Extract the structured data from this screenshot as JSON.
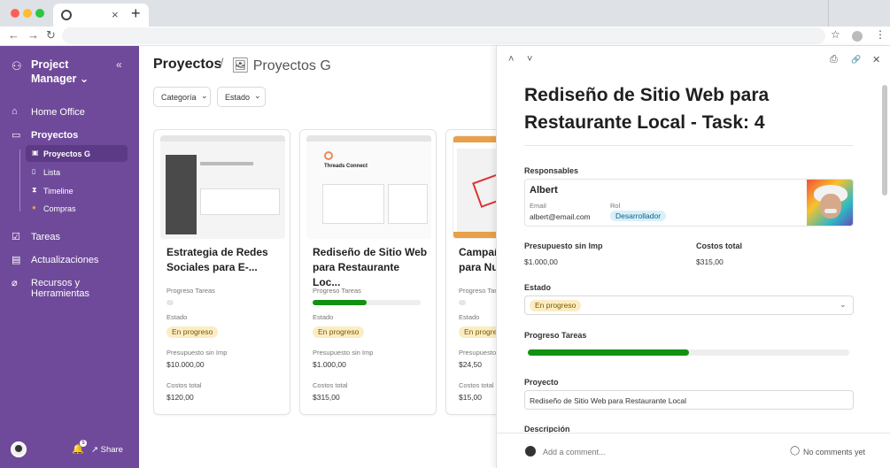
{
  "browser": {
    "tab_close": "×",
    "new_tab": "+",
    "back": "←",
    "forward": "→",
    "reload": "↻",
    "star": "☆",
    "menu": "⋮"
  },
  "sidebar": {
    "brand": "Project Manager",
    "brand_caret": "⌄",
    "collapse": "«",
    "items": [
      {
        "label": "Home Office",
        "icon": "home-icon",
        "glyph": "⌂"
      },
      {
        "label": "Proyectos",
        "icon": "folder-icon",
        "glyph": "▭"
      },
      {
        "label": "Tareas",
        "icon": "checkbox-icon",
        "glyph": "☑"
      },
      {
        "label": "Actualizaciones",
        "icon": "inbox-icon",
        "glyph": "▤"
      },
      {
        "label": "Recursos y Herramientas",
        "icon": "paperclip-icon",
        "glyph": "⌀"
      }
    ],
    "sub_items": [
      {
        "label": "Proyectos G",
        "icon": "picture-icon",
        "glyph": "▣"
      },
      {
        "label": "Lista",
        "icon": "page-icon",
        "glyph": "▯"
      },
      {
        "label": "Timeline",
        "icon": "hourglass-icon",
        "glyph": "⧗"
      },
      {
        "label": "Compras",
        "icon": "bag-icon",
        "glyph": "●"
      }
    ],
    "notifications_count": "5",
    "bell": "🔔",
    "share": "Share"
  },
  "main": {
    "breadcrumb_root": "Proyectos",
    "breadcrumb_sep": "/",
    "breadcrumb_current": "🖼 Proyectos G",
    "filters": [
      "Categoría",
      "Estado"
    ],
    "filter_caret": "⌄",
    "labels": {
      "progress": "Progreso Tareas",
      "status": "Estado",
      "budget": "Presupuesto sin Imp",
      "costs": "Costos total"
    },
    "cards": [
      {
        "title": "Estrategia de Redes Sociales para E-...",
        "status": "En progreso",
        "progress": 0,
        "budget": "$10.000,00",
        "costs": "$120,00"
      },
      {
        "title": "Rediseño de Sitio Web para Restaurante Loc...",
        "status": "En progreso",
        "progress": 0.5,
        "budget": "$1.000,00",
        "costs": "$315,00"
      },
      {
        "title": "Campaña de Marketing para Nu...",
        "status": "En progreso",
        "progress": 0,
        "budget": "$24,50",
        "costs": "$15,00"
      }
    ]
  },
  "panel": {
    "toolbar": {
      "up": "˄",
      "down": "˅",
      "print": "⎙",
      "link": "🔗",
      "close": "✕"
    },
    "title": "Rediseño de Sitio Web para Restaurante Local - Task: 4",
    "responsables_label": "Responsables",
    "person": {
      "name": "Albert",
      "email_label": "Email",
      "email": "albert@email.com",
      "role_label": "Rol",
      "role": "Desarrollador"
    },
    "budget_label": "Presupuesto sin Imp",
    "budget": "$1.000,00",
    "costs_label": "Costos total",
    "costs": "$315,00",
    "status_label": "Estado",
    "status": "En progreso",
    "progress_label": "Progreso Tareas",
    "progress": 0.5,
    "project_label": "Proyecto",
    "project": "Rediseño de Sitio Web para Restaurante Local",
    "description_label": "Descripción",
    "comment_placeholder": "Add a comment...",
    "no_comments": "No comments yet",
    "comment_icon": "◯"
  },
  "colors": {
    "sidebar": "#6f4a9a",
    "progress": "#139113",
    "status_pill": "#fbecc3",
    "role_pill": "#d8f0fa"
  }
}
